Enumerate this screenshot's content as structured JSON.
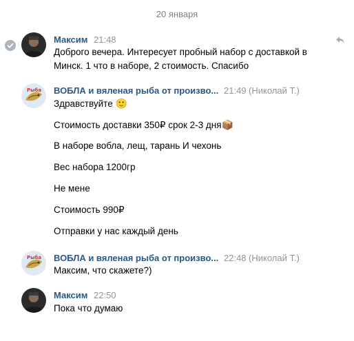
{
  "date_separator": "20 января",
  "messages": [
    {
      "author": "Максим",
      "time": "21:48",
      "text": "Доброго вечера. Интересует пробный набор с доставкой в Минск. 1 что в наборе, 2 стоимость. Спасибо"
    },
    {
      "author": "ВОБЛА и вяленая рыба от произво...",
      "time": "21:49",
      "sender": "(Николай Т.)",
      "lines": [
        "Здравствуйте",
        "Стоимость доставки 350₽ срок 2-3 дня",
        "В наборе вобла, лещ, тарань И чехонь",
        "Вес набора 1200гр",
        "Не мене",
        "Стоимость 990₽",
        "Отправки у нас каждый день"
      ],
      "emoji_smile": "🙂",
      "emoji_box": "📦"
    },
    {
      "author": "ВОБЛА и вяленая рыба от произво...",
      "time": "22:48",
      "sender": "(Николай Т.)",
      "text": "Максим, что скажете?)"
    },
    {
      "author": "Максим",
      "time": "22:50",
      "text": "Пока что думаю"
    }
  ],
  "colors": {
    "author": "#2a5885",
    "meta": "#939393",
    "accent_check": "#aab4c0"
  },
  "icons": {
    "read_check": "check-icon",
    "reply": "reply-icon"
  }
}
